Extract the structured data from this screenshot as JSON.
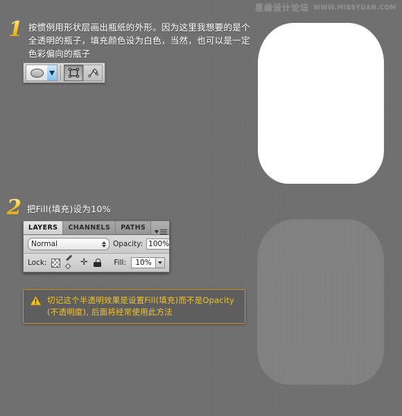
{
  "watermark": {
    "cn": "思缘设计论坛",
    "url": "WWW.MISSYUAN.COM"
  },
  "steps": [
    {
      "number": "1",
      "text": "按惯例用形状层画出瓶纸的外形。因为这里我想要的是个全透明的瓶子，填充颜色设为白色，当然，也可以是一定色彩偏向的瓶子"
    },
    {
      "number": "2",
      "text": "把Fill(填充)设为10%"
    }
  ],
  "toolbar": {
    "shape_tool_icon": "ellipse-shape-icon",
    "shape_dropdown_icon": "caret-down-icon",
    "shape_layer_icon": "shape-layer-icon",
    "paths_icon": "paths-icon"
  },
  "layers_panel": {
    "tabs": [
      {
        "label": "LAYERS",
        "active": true
      },
      {
        "label": "CHANNELS",
        "active": false
      },
      {
        "label": "PATHS",
        "active": false
      }
    ],
    "menu_icon": "panel-menu-icon",
    "blend_mode": "Normal",
    "opacity_label": "Opacity:",
    "opacity_value": "100%",
    "lock_label": "Lock:",
    "lock_icons": [
      "lock-transparency-icon",
      "lock-image-pixels-icon",
      "lock-position-icon",
      "lock-all-icon"
    ],
    "fill_label": "Fill:",
    "fill_value": "10%"
  },
  "note": {
    "icon": "warning-triangle-icon",
    "line1": "切记这个半透明效果是设置Fill(填充)而不是Opacity",
    "line2": "(不透明度), 后面将经常使用此方法",
    "border_color": "#c8962a",
    "text_color": "#f2c42a"
  },
  "canvas": {
    "shape_top_name": "white-bottle-shape",
    "shape_bottom_name": "transparent-bottle-shape",
    "shape_top_color": "#ffffff",
    "shape_bottom_color": "rgba(255,255,255,0.12)"
  },
  "background_color": "#6f6f6f"
}
